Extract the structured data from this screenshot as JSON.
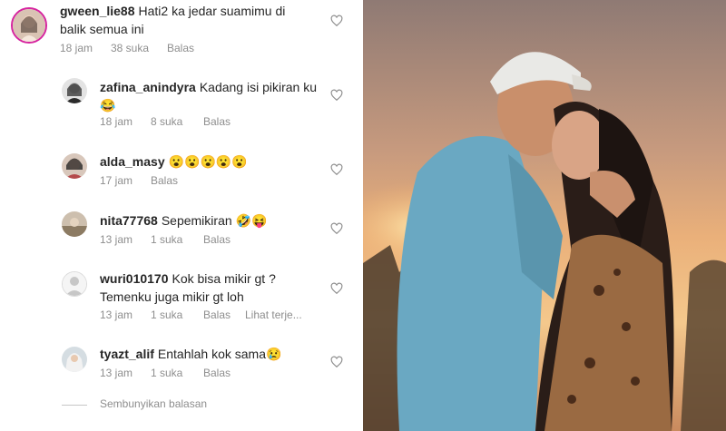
{
  "comments": [
    {
      "username": "gween_lie88",
      "text": "Hati2 ka jedar suamimu di",
      "text2": "balik semua ini",
      "time": "18 jam",
      "likes": "38 suka",
      "reply": "Balas"
    },
    {
      "username": "zafina_anindyra",
      "text": "Kadang isi pikiran ku",
      "text2": "😂",
      "time": "18 jam",
      "likes": "8 suka",
      "reply": "Balas"
    },
    {
      "username": "alda_masy",
      "text": "😮😮😮😮😮",
      "time": "17 jam",
      "reply": "Balas"
    },
    {
      "username": "nita77768",
      "text": "Sepemikiran 🤣😝",
      "time": "13 jam",
      "likes": "1 suka",
      "reply": "Balas"
    },
    {
      "username": "wuri010170",
      "text": "Kok bisa mikir gt ?",
      "text2": "Temenku juga mikir gt loh",
      "time": "13 jam",
      "likes": "1 suka",
      "reply": "Balas",
      "more": "Lihat terje..."
    },
    {
      "username": "tyazt_alif",
      "text": "Entahlah kok sama😢",
      "time": "13 jam",
      "likes": "1 suka",
      "reply": "Balas"
    }
  ],
  "hide_replies": "Sembunyikan balasan",
  "colors": {
    "text": "#262626",
    "meta": "#8e8e8e",
    "sky_top": "#b9998a",
    "sky_mid": "#e8a565",
    "sun": "#f6c27a"
  }
}
